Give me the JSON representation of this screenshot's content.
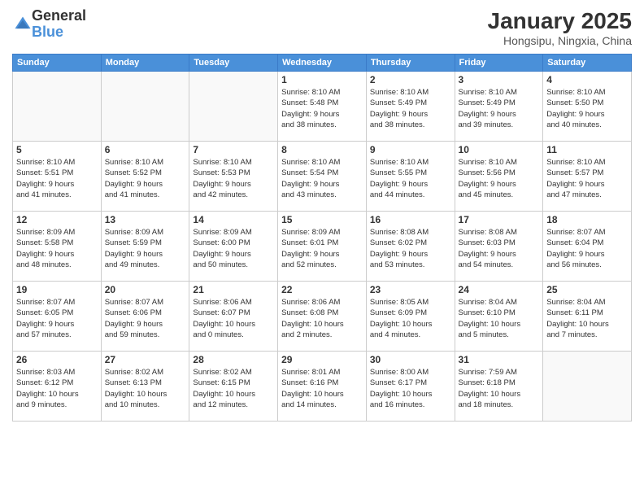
{
  "logo": {
    "general": "General",
    "blue": "Blue"
  },
  "title": "January 2025",
  "subtitle": "Hongsipu, Ningxia, China",
  "days_header": [
    "Sunday",
    "Monday",
    "Tuesday",
    "Wednesday",
    "Thursday",
    "Friday",
    "Saturday"
  ],
  "weeks": [
    [
      {
        "day": "",
        "info": ""
      },
      {
        "day": "",
        "info": ""
      },
      {
        "day": "",
        "info": ""
      },
      {
        "day": "1",
        "info": "Sunrise: 8:10 AM\nSunset: 5:48 PM\nDaylight: 9 hours\nand 38 minutes."
      },
      {
        "day": "2",
        "info": "Sunrise: 8:10 AM\nSunset: 5:49 PM\nDaylight: 9 hours\nand 38 minutes."
      },
      {
        "day": "3",
        "info": "Sunrise: 8:10 AM\nSunset: 5:49 PM\nDaylight: 9 hours\nand 39 minutes."
      },
      {
        "day": "4",
        "info": "Sunrise: 8:10 AM\nSunset: 5:50 PM\nDaylight: 9 hours\nand 40 minutes."
      }
    ],
    [
      {
        "day": "5",
        "info": "Sunrise: 8:10 AM\nSunset: 5:51 PM\nDaylight: 9 hours\nand 41 minutes."
      },
      {
        "day": "6",
        "info": "Sunrise: 8:10 AM\nSunset: 5:52 PM\nDaylight: 9 hours\nand 41 minutes."
      },
      {
        "day": "7",
        "info": "Sunrise: 8:10 AM\nSunset: 5:53 PM\nDaylight: 9 hours\nand 42 minutes."
      },
      {
        "day": "8",
        "info": "Sunrise: 8:10 AM\nSunset: 5:54 PM\nDaylight: 9 hours\nand 43 minutes."
      },
      {
        "day": "9",
        "info": "Sunrise: 8:10 AM\nSunset: 5:55 PM\nDaylight: 9 hours\nand 44 minutes."
      },
      {
        "day": "10",
        "info": "Sunrise: 8:10 AM\nSunset: 5:56 PM\nDaylight: 9 hours\nand 45 minutes."
      },
      {
        "day": "11",
        "info": "Sunrise: 8:10 AM\nSunset: 5:57 PM\nDaylight: 9 hours\nand 47 minutes."
      }
    ],
    [
      {
        "day": "12",
        "info": "Sunrise: 8:09 AM\nSunset: 5:58 PM\nDaylight: 9 hours\nand 48 minutes."
      },
      {
        "day": "13",
        "info": "Sunrise: 8:09 AM\nSunset: 5:59 PM\nDaylight: 9 hours\nand 49 minutes."
      },
      {
        "day": "14",
        "info": "Sunrise: 8:09 AM\nSunset: 6:00 PM\nDaylight: 9 hours\nand 50 minutes."
      },
      {
        "day": "15",
        "info": "Sunrise: 8:09 AM\nSunset: 6:01 PM\nDaylight: 9 hours\nand 52 minutes."
      },
      {
        "day": "16",
        "info": "Sunrise: 8:08 AM\nSunset: 6:02 PM\nDaylight: 9 hours\nand 53 minutes."
      },
      {
        "day": "17",
        "info": "Sunrise: 8:08 AM\nSunset: 6:03 PM\nDaylight: 9 hours\nand 54 minutes."
      },
      {
        "day": "18",
        "info": "Sunrise: 8:07 AM\nSunset: 6:04 PM\nDaylight: 9 hours\nand 56 minutes."
      }
    ],
    [
      {
        "day": "19",
        "info": "Sunrise: 8:07 AM\nSunset: 6:05 PM\nDaylight: 9 hours\nand 57 minutes."
      },
      {
        "day": "20",
        "info": "Sunrise: 8:07 AM\nSunset: 6:06 PM\nDaylight: 9 hours\nand 59 minutes."
      },
      {
        "day": "21",
        "info": "Sunrise: 8:06 AM\nSunset: 6:07 PM\nDaylight: 10 hours\nand 0 minutes."
      },
      {
        "day": "22",
        "info": "Sunrise: 8:06 AM\nSunset: 6:08 PM\nDaylight: 10 hours\nand 2 minutes."
      },
      {
        "day": "23",
        "info": "Sunrise: 8:05 AM\nSunset: 6:09 PM\nDaylight: 10 hours\nand 4 minutes."
      },
      {
        "day": "24",
        "info": "Sunrise: 8:04 AM\nSunset: 6:10 PM\nDaylight: 10 hours\nand 5 minutes."
      },
      {
        "day": "25",
        "info": "Sunrise: 8:04 AM\nSunset: 6:11 PM\nDaylight: 10 hours\nand 7 minutes."
      }
    ],
    [
      {
        "day": "26",
        "info": "Sunrise: 8:03 AM\nSunset: 6:12 PM\nDaylight: 10 hours\nand 9 minutes."
      },
      {
        "day": "27",
        "info": "Sunrise: 8:02 AM\nSunset: 6:13 PM\nDaylight: 10 hours\nand 10 minutes."
      },
      {
        "day": "28",
        "info": "Sunrise: 8:02 AM\nSunset: 6:15 PM\nDaylight: 10 hours\nand 12 minutes."
      },
      {
        "day": "29",
        "info": "Sunrise: 8:01 AM\nSunset: 6:16 PM\nDaylight: 10 hours\nand 14 minutes."
      },
      {
        "day": "30",
        "info": "Sunrise: 8:00 AM\nSunset: 6:17 PM\nDaylight: 10 hours\nand 16 minutes."
      },
      {
        "day": "31",
        "info": "Sunrise: 7:59 AM\nSunset: 6:18 PM\nDaylight: 10 hours\nand 18 minutes."
      },
      {
        "day": "",
        "info": ""
      }
    ]
  ]
}
